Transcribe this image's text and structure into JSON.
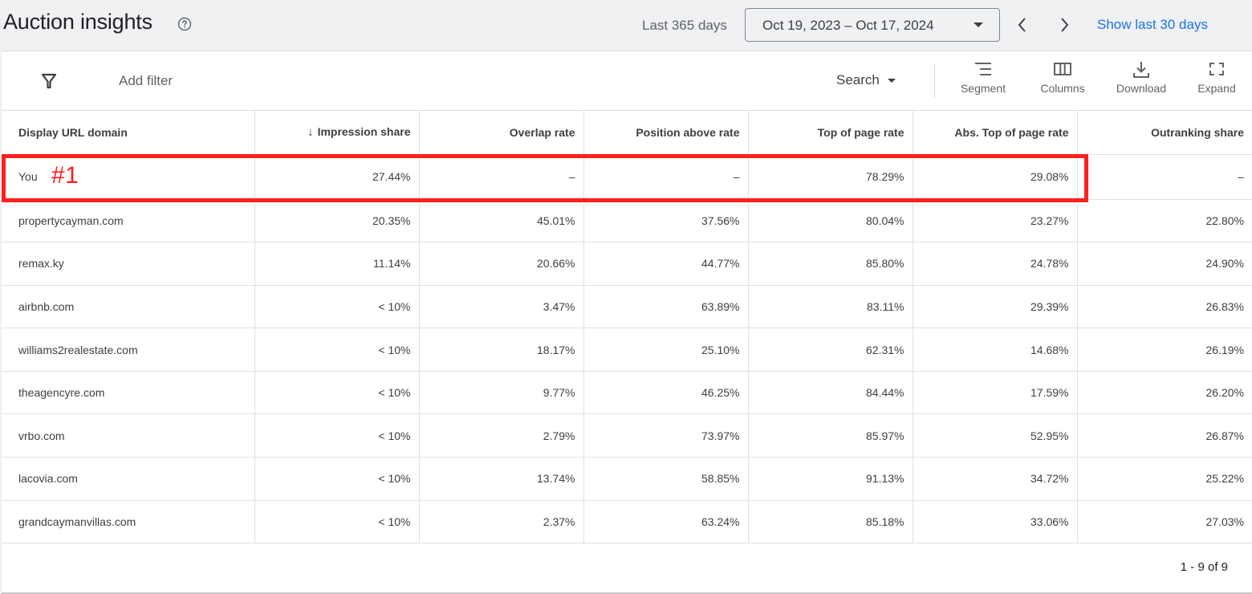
{
  "header": {
    "title": "Auction insights",
    "help_icon": "help-circle-icon",
    "range_label": "Last 365 days",
    "date_range": "Oct 19, 2023 – Oct 17, 2024",
    "prev_icon": "chevron-left-icon",
    "next_icon": "chevron-right-icon",
    "show_link": "Show last 30 days",
    "link_color": "#1a73e8"
  },
  "toolbar": {
    "filter_icon": "filter-icon",
    "add_filter": "Add filter",
    "network_dropdown": "Search",
    "tools": [
      {
        "label": "Segment",
        "icon": "segment-icon"
      },
      {
        "label": "Columns",
        "icon": "columns-icon"
      },
      {
        "label": "Download",
        "icon": "download-icon"
      },
      {
        "label": "Expand",
        "icon": "expand-icon"
      }
    ]
  },
  "table": {
    "sort_indicator": "↓",
    "columns": [
      "Display URL domain",
      "Impression share",
      "Overlap rate",
      "Position above rate",
      "Top of page rate",
      "Abs. Top of page rate",
      "Outranking share"
    ],
    "rows": [
      [
        "You",
        "27.44%",
        "–",
        "–",
        "78.29%",
        "29.08%",
        "–"
      ],
      [
        "propertycayman.com",
        "20.35%",
        "45.01%",
        "37.56%",
        "80.04%",
        "23.27%",
        "22.80%"
      ],
      [
        "remax.ky",
        "11.14%",
        "20.66%",
        "44.77%",
        "85.80%",
        "24.78%",
        "24.90%"
      ],
      [
        "airbnb.com",
        "< 10%",
        "3.47%",
        "63.89%",
        "83.11%",
        "29.39%",
        "26.83%"
      ],
      [
        "williams2realestate.com",
        "< 10%",
        "18.17%",
        "25.10%",
        "62.31%",
        "14.68%",
        "26.19%"
      ],
      [
        "theagencyre.com",
        "< 10%",
        "9.77%",
        "46.25%",
        "84.44%",
        "17.59%",
        "26.20%"
      ],
      [
        "vrbo.com",
        "< 10%",
        "2.79%",
        "73.97%",
        "85.97%",
        "52.95%",
        "26.87%"
      ],
      [
        "lacovia.com",
        "< 10%",
        "13.74%",
        "58.85%",
        "91.13%",
        "34.72%",
        "25.22%"
      ],
      [
        "grandcaymanvillas.com",
        "< 10%",
        "2.37%",
        "63.24%",
        "85.18%",
        "33.06%",
        "27.03%"
      ]
    ]
  },
  "pagination": "1 - 9 of 9",
  "annotation": {
    "label": "#1",
    "color": "#ff1f1f"
  }
}
